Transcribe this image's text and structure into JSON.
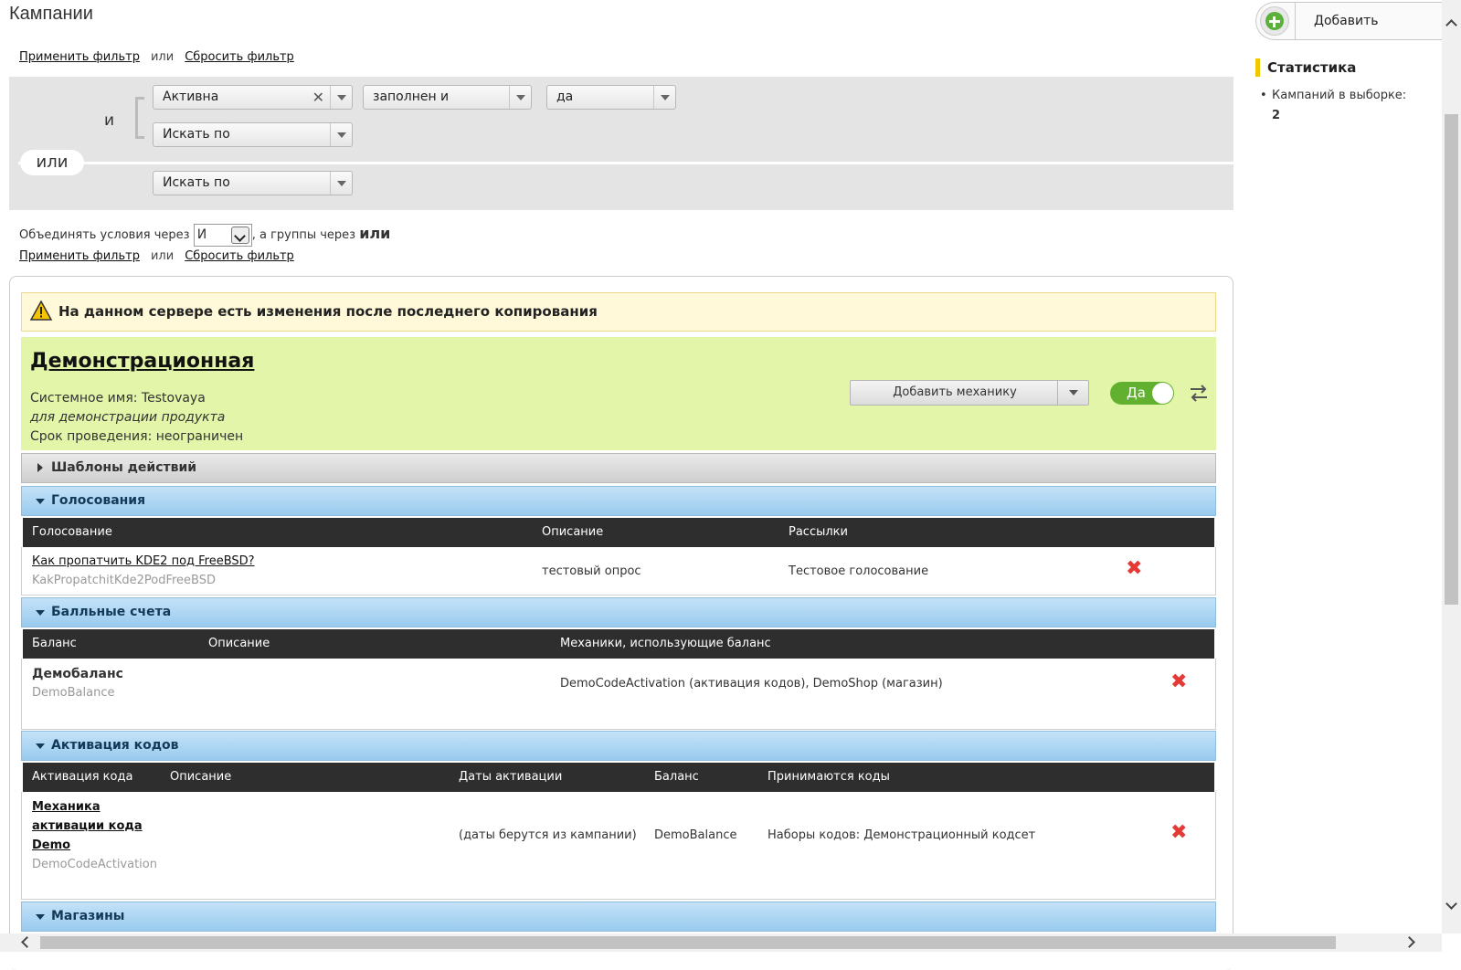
{
  "page": {
    "title": "Кампании"
  },
  "filter": {
    "apply_label": "Применить фильтр",
    "or_label": "или",
    "reset_label": "Сбросить фильтр",
    "and_label": "и",
    "or_pill": "или",
    "cond1_field": "Активна",
    "cond1_op": "заполнен и",
    "cond1_val": "да",
    "cond2_field": "Искать по",
    "group2_field": "Искать по",
    "combine_prefix": "Объединять условия через",
    "combine_select": "И",
    "combine_mid": ", а группы через",
    "combine_groups": "или"
  },
  "warning": {
    "text": "На данном сервере есть изменения после последнего копирования"
  },
  "campaign": {
    "name": "Демонстрационная",
    "system_name": "Системное имя: Testovaya",
    "description": "для демонстрации продукта",
    "duration": "Срок проведения: неограничен",
    "add_mechanic_label": "Добавить механику",
    "toggle_label": "Да"
  },
  "sections": {
    "templates": "Шаблоны действий",
    "votes": "Голосования",
    "points": "Балльные счета",
    "codes": "Активация кодов",
    "shops": "Магазины"
  },
  "votes_table": {
    "headers": [
      "Голосование",
      "Описание",
      "Рассылки"
    ],
    "row": {
      "title": "Как пропатчить KDE2 под FreeBSD?",
      "system": "KakPropatchitKde2PodFreeBSD",
      "description": "тестовый опрос",
      "mailing": "Тестовое голосование"
    }
  },
  "points_table": {
    "headers": [
      "Баланс",
      "Описание",
      "Механики, использующие баланс"
    ],
    "row": {
      "title": "Демобаланс",
      "system": "DemoBalance",
      "mechanics": "DemoCodeActivation (активация кодов), DemoShop (магазин)"
    }
  },
  "codes_table": {
    "headers": [
      "Активация кода",
      "Описание",
      "Даты активации",
      "Баланс",
      "Принимаются коды"
    ],
    "row": {
      "title_1": "Механика",
      "title_2": "активации кода",
      "title_3": "Demo",
      "system": "DemoCodeActivation",
      "dates": "(даты берутся из кампании)",
      "balance": "DemoBalance",
      "codes": "Наборы кодов: Демонстрационный кодсет"
    }
  },
  "sidebar": {
    "add_label": "Добавить",
    "stats_title": "Статистика",
    "stat_label": "Кампаний в выборке:",
    "stat_value": "2"
  },
  "icons": {
    "delete": "close-x-icon",
    "warning": "warning-triangle-icon",
    "swap": "swap-arrows-icon",
    "add": "plus-circle-icon"
  },
  "colors": {
    "campaign_bg": "#e2f5a8",
    "section_blue": "#99cbee",
    "warning_bg": "#fff8d9",
    "delete_red": "#e53935",
    "toggle_green": "#62b02f",
    "stats_accent": "#f0c800"
  }
}
